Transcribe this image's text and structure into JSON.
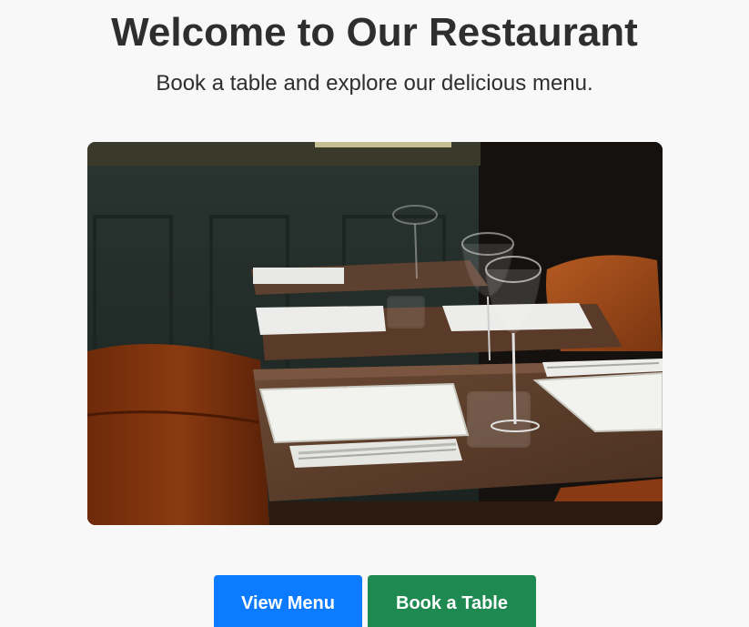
{
  "header": {
    "title": "Welcome to Our Restaurant",
    "subtitle": "Book a table and explore our delicious menu."
  },
  "hero": {
    "image_subject": "restaurant-table-setting"
  },
  "actions": {
    "view_menu_label": "View Menu",
    "book_table_label": "Book a Table"
  },
  "colors": {
    "primary": "#0d7bff",
    "success": "#1e8a51",
    "background": "#f8f8f8",
    "text": "#333333"
  }
}
